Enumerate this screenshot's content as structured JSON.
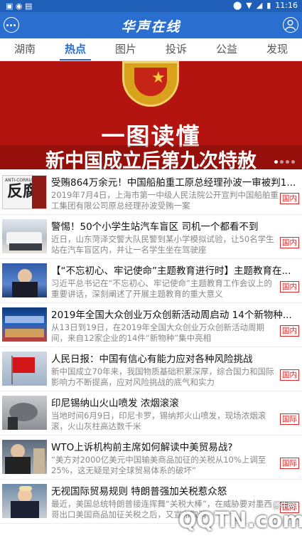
{
  "status_bar": {
    "time": "11:16",
    "left_icons": [
      "browser-icon",
      "circle-icon",
      "image-icon"
    ],
    "right_icons": [
      "location-icon",
      "wifi-icon",
      "signal-icon",
      "battery-icon"
    ]
  },
  "header": {
    "app_title": "华声在线",
    "colors": {
      "primary": "#2a6fd0",
      "accent": "#d92a2a"
    }
  },
  "tabs": [
    {
      "label": "湖南"
    },
    {
      "label": "热点",
      "active": true
    },
    {
      "label": "图片"
    },
    {
      "label": "投诉"
    },
    {
      "label": "公益"
    },
    {
      "label": "发现"
    }
  ],
  "banner": {
    "title": "一图读懂",
    "subtitle": "新中国成立后第九次特赦",
    "slide_dots": 4,
    "active_dot": 1
  },
  "news": [
    {
      "title": "受贿864万余元！中国船舶重工原总经理孙波一审被判1...",
      "summary": "2019年7月4日，上海市第一中级人民法院公开宣判中国船舶重工集团有限公司原总经理孙波受贿一案",
      "tag": "国内",
      "thumb_text_small": "ANTI-CORRUPTION",
      "thumb_text_big": "反腐"
    },
    {
      "title": "警惕！50个小学生站汽车盲区 司机一个都看不到",
      "summary": "近日，山东菏泽交警大队民警到某小学模拟试验，让50名学生站在汽车盲区内，并让一名学生坐在驾驶座",
      "tag": "国内"
    },
    {
      "title": "【“不忘初心、牢记使命”主题教育进行时】主题教育在...",
      "summary": "习近平总书记在“不忘初心、牢记使命”主题教育工作会议上的重要讲话，深刻阐述了开展主题教育的重大意义",
      "tag": "国内"
    },
    {
      "title": "2019年全国大众创业万众创新活动周启动 14个新物种...",
      "summary": "从13日到19日，在2019年全国大众创业万众创新活动周期间，来自12家企业的14件“新物种”集中亮相",
      "tag": "国内"
    },
    {
      "title": "人民日报：中国有信心有能力应对各种风险挑战",
      "summary": "新中国成立70年来，我国物质基础积累深厚，综合国力和国际影响力不断提高，应对风险挑战的底气和实力",
      "tag": "国内"
    },
    {
      "title": "印尼锡纳山火山喷发 浓烟滚滚",
      "summary": "当地时间6月9日，印尼卡罗，锡纳邦火山喷发，现场浓烟滚滚，火山灰柱高达数千米",
      "tag": "国际"
    },
    {
      "title": "WTO上诉机构前主席如何解读中美贸易战?",
      "summary": "“美方对2000亿美元中国输美商品加征的关税从10%上调至25%，这无疑是对全球贸易体系的破坏”",
      "tag": "国际"
    },
    {
      "title": "无视国际贸易规则 特朗普强加关税惹众怒",
      "summary": "最近，美国总统特朗普接连挥舞“关税大棒”，在威胁要对墨西哥出口美国商品加征关税之后，又宣布取消",
      "tag": "国际"
    }
  ],
  "watermark": {
    "text": "QQTN.com",
    "small": "腾牛网"
  }
}
